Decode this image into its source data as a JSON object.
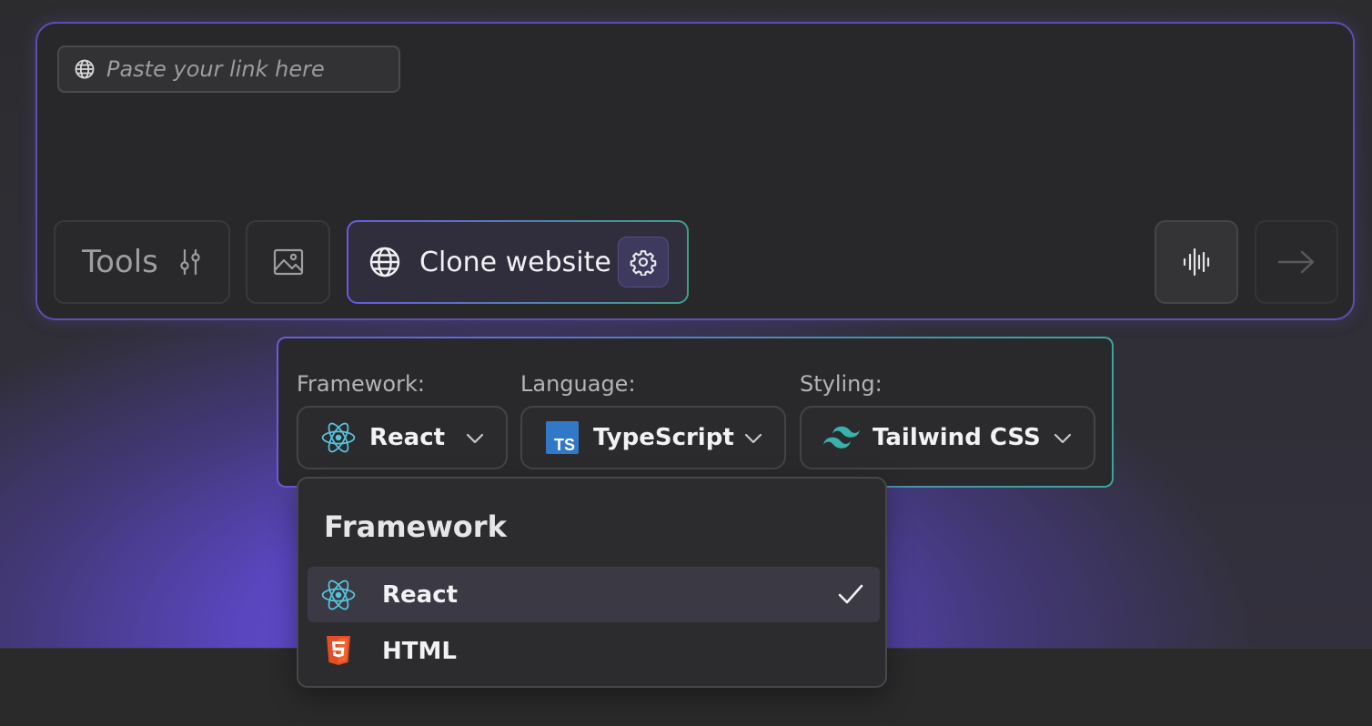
{
  "prompt": {
    "link_placeholder": "Paste your link here",
    "tools_label": "Tools",
    "clone_label": "Clone website"
  },
  "settings": {
    "framework_label": "Framework:",
    "framework_value": "React",
    "language_label": "Language:",
    "language_value": "TypeScript",
    "language_badge": "TS",
    "styling_label": "Styling:",
    "styling_value": "Tailwind CSS"
  },
  "dropdown": {
    "title": "Framework",
    "items": [
      {
        "label": "React",
        "icon": "react-icon",
        "selected": true
      },
      {
        "label": "HTML",
        "icon": "html5-icon",
        "selected": false
      }
    ]
  },
  "colors": {
    "accent_purple": "#6a5ae0",
    "accent_teal": "#3fa08a",
    "react_blue": "#58c4dc",
    "ts_blue": "#3178c6",
    "tailwind_teal": "#38bdf8",
    "html_orange": "#e44d26"
  }
}
